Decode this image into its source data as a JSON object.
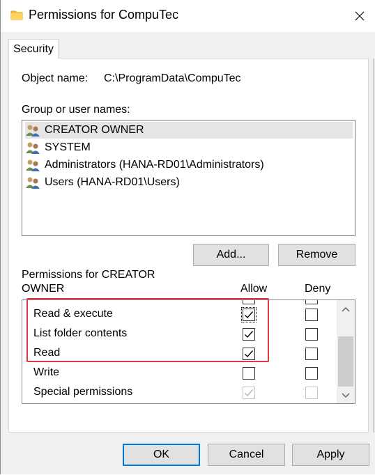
{
  "window": {
    "title": "Permissions for CompuTec",
    "close_icon": "close-icon",
    "folder_icon": "folder-icon"
  },
  "tabs": [
    {
      "label": "Security",
      "active": true
    }
  ],
  "object": {
    "label": "Object name:",
    "value": "C:\\ProgramData\\CompuTec"
  },
  "groups": {
    "label": "Group or user names:",
    "items": [
      {
        "name": "CREATOR OWNER",
        "selected": true,
        "icon": "users-icon"
      },
      {
        "name": "SYSTEM",
        "selected": false,
        "icon": "users-icon"
      },
      {
        "name": "Administrators (HANA-RD01\\Administrators)",
        "selected": false,
        "icon": "users-icon"
      },
      {
        "name": "Users (HANA-RD01\\Users)",
        "selected": false,
        "icon": "users-icon"
      }
    ]
  },
  "buttons": {
    "add": "Add...",
    "remove": "Remove",
    "ok": "OK",
    "cancel": "Cancel",
    "apply": "Apply"
  },
  "permissions": {
    "label_line1": "Permissions for CREATOR",
    "label_line2": "OWNER",
    "allow_header": "Allow",
    "deny_header": "Deny",
    "rows": [
      {
        "name": "Read & execute",
        "allow": true,
        "deny": false,
        "disabled": false
      },
      {
        "name": "List folder contents",
        "allow": true,
        "deny": false,
        "disabled": false
      },
      {
        "name": "Read",
        "allow": true,
        "deny": false,
        "disabled": false
      },
      {
        "name": "Write",
        "allow": false,
        "deny": false,
        "disabled": false
      },
      {
        "name": "Special permissions",
        "allow": true,
        "deny": false,
        "disabled": true
      }
    ]
  },
  "colors": {
    "highlight": "#e0393e",
    "focus": "#0078d7"
  }
}
